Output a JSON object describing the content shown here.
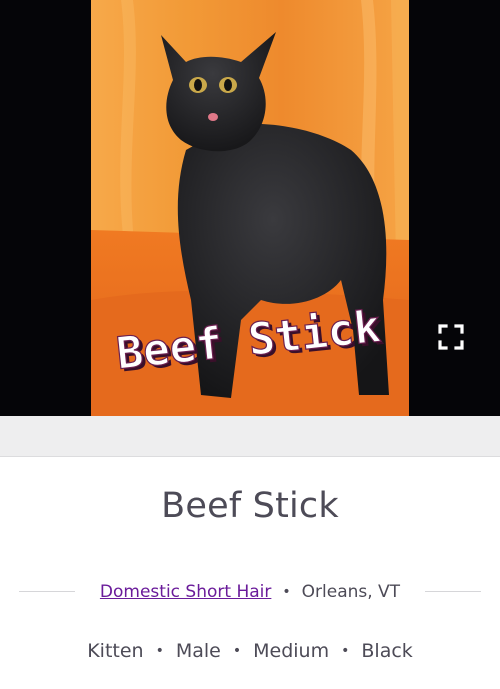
{
  "pet": {
    "name": "Beef Stick",
    "photo_caption": "Beef Stick",
    "breed": "Domestic Short Hair",
    "location": "Orleans, VT",
    "age": "Kitten",
    "sex": "Male",
    "size": "Medium",
    "color": "Black"
  },
  "separator": "•",
  "icons": {
    "fullscreen": "fullscreen-icon"
  },
  "colors": {
    "link": "#6a1b9a",
    "text": "#4d4b57",
    "band": "#eeeeef",
    "photo_bg": "#050508",
    "photo_orange": "#f28c2a"
  }
}
